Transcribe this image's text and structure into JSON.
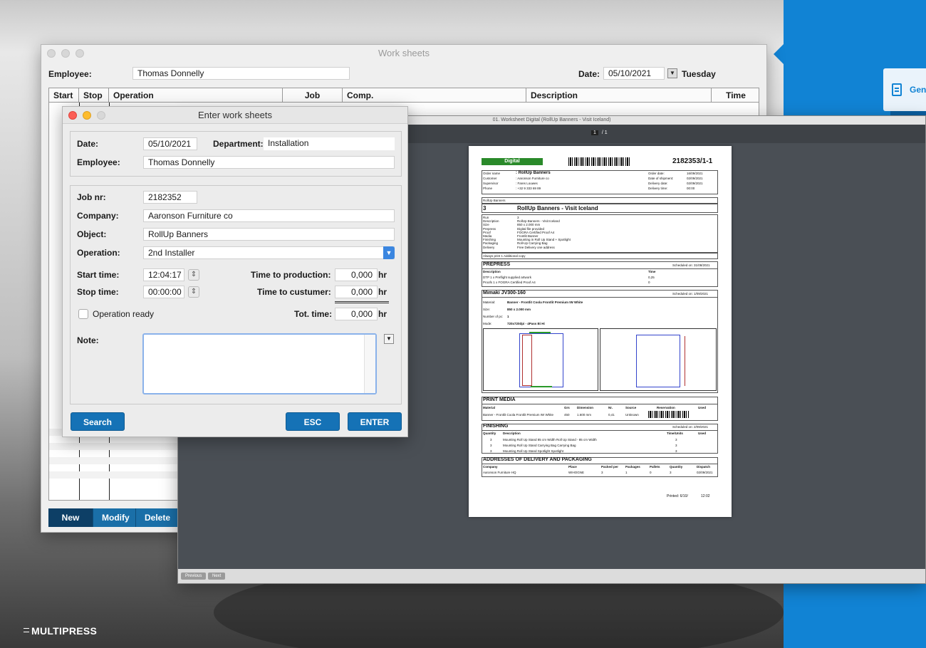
{
  "brand": {
    "logo_text": "MULTIPRESS",
    "side_card_label": "Gene"
  },
  "worksheets": {
    "title": "Work sheets",
    "employee_label": "Employee:",
    "employee_value": "Thomas Donnelly",
    "date_label": "Date:",
    "date_value": "05/10/2021",
    "weekday": "Tuesday",
    "columns": [
      "Start",
      "Stop",
      "Operation",
      "Job",
      "Comp.",
      "Description",
      "Time"
    ],
    "buttons": {
      "new": "New",
      "modify": "Modify",
      "delete": "Delete"
    }
  },
  "dialog": {
    "title": "Enter work sheets",
    "date_label": "Date:",
    "date_value": "05/10/2021",
    "department_label": "Department:",
    "department_value": "Installation",
    "employee_label": "Employee:",
    "employee_value": "Thomas Donnelly",
    "job_label": "Job nr:",
    "job_value": "2182352",
    "company_label": "Company:",
    "company_value": "Aaronson Furniture co",
    "object_label": "Object:",
    "object_value": "RollUp Banners",
    "operation_label": "Operation:",
    "operation_value": "2nd Installer",
    "start_label": "Start time:",
    "start_value": "12:04:17",
    "stop_label": "Stop time:",
    "stop_value": "00:00:00",
    "ttp_label": "Time to production:",
    "ttp_value": "0,000",
    "ttc_label": "Time to custumer:",
    "ttc_value": "0,000",
    "tot_label": "Tot. time:",
    "tot_value": "0,000",
    "unit": "hr",
    "ready_label": "Operation ready",
    "note_label": "Note:",
    "buttons": {
      "search": "Search",
      "esc": "ESC",
      "enter": "ENTER"
    }
  },
  "pdf": {
    "title": "01. Worksheet Digital (RollUp Banners - Visit Iceland)",
    "page_current": "1",
    "page_total": "/ 1",
    "prev": "Previous",
    "next": "Next",
    "doc": {
      "badge": "Digital",
      "number": "2182353/1-1",
      "info_left": [
        [
          "Order name",
          ": RollUp Banners"
        ],
        [
          "Customer",
          ": Aaronson Furniture co"
        ],
        [
          "Supervisor",
          ": Fares Louwes"
        ],
        [
          "Phone",
          ": +32 9 333 69 89"
        ]
      ],
      "info_right": [
        [
          "Order date:",
          "16/09/2021"
        ],
        [
          "Date of shipment:",
          "02/09/2021"
        ],
        [
          "Delivery date:",
          "02/09/2021"
        ],
        [
          "Delivery time:",
          "00:00"
        ]
      ],
      "product_header": "RollUp Banners",
      "qty": "3",
      "product_title": "RollUp Banners - Visit Iceland",
      "specs": [
        [
          "Run",
          "3"
        ],
        [
          "Description",
          "RollUp Banners - Visit Iceland"
        ],
        [
          "Size",
          "850 x 2.000 mm"
        ],
        [
          "Prepress",
          "Digital file provided"
        ],
        [
          "Proof",
          "FOGRA Certified Proof A4"
        ],
        [
          "Media",
          "Frontlit Banner"
        ],
        [
          "Finishing",
          "Mounting in Roll Up Stand + Spotlight"
        ],
        [
          "Packaging",
          "Roll-Up Carrying Bag"
        ],
        [
          "Delivery",
          "Free Delivery one address"
        ]
      ],
      "note_line": "Always print 1 Additional copy",
      "prepress_title": "PREPRESS",
      "prepress_sched": "Scheduled on: 31/08/2021",
      "prepress_cols": [
        "Description",
        "Time"
      ],
      "prepress_rows": [
        [
          "DTP 1 x Preflight supplied artwork",
          "0,25"
        ],
        [
          "Proofs 1 x FOGRA Certified Proof A4",
          "0"
        ]
      ],
      "machine_title": "Mimaki JV300-160",
      "machine_sched": "Scheduled on: 1/09/2021",
      "machine_rows": [
        [
          "Material:",
          "Banner - Frontlit Coola Frontlit Premium IW White"
        ],
        [
          "Size:",
          "850 x 2.000 mm"
        ],
        [
          "Number of pc:",
          "1"
        ],
        [
          "Mode:",
          "720x720dpi - 4Pass Bi Hi"
        ]
      ],
      "media_title": "PRINT MEDIA",
      "media_cols": [
        "Material",
        "Grs",
        "Dimension",
        "Nr.",
        "Source",
        "Reservation",
        "Used"
      ],
      "media_row": [
        "Banner - Frontlit Coola Frontlit Premium IW White",
        "450",
        "1.600 mm",
        "0,41",
        "Unknown"
      ],
      "finishing_title": "FINISHING",
      "finishing_sched": "Scheduled on: 2/09/2021",
      "finishing_cols": [
        "Quantity",
        "Description",
        "Time/Units",
        "Used"
      ],
      "finishing_rows": [
        [
          "3",
          "Mounting Roll Up Stand 85 cm Width Roll Up Stand - 85 cm Width",
          "3"
        ],
        [
          "3",
          "Mounting Roll Up Stand Carrying Bag Carrying Bag",
          "3"
        ],
        [
          "3",
          "Mounting Roll Up Stand Spotlight Spotlight",
          "3"
        ]
      ],
      "address_title": "ADDRESSES OF DELIVERY AND PACKAGING",
      "address_cols": [
        "Company",
        "Place",
        "Packed per",
        "Packages",
        "Pallets",
        "Quantity",
        "Dispatch"
      ],
      "address_row": [
        "Aaronson Furniture HQ",
        "WIHOGNE",
        "3",
        "1",
        "0",
        "3",
        "02/09/2021"
      ],
      "printed": "Printed: 6/10/",
      "printed_time": "12:02"
    }
  }
}
